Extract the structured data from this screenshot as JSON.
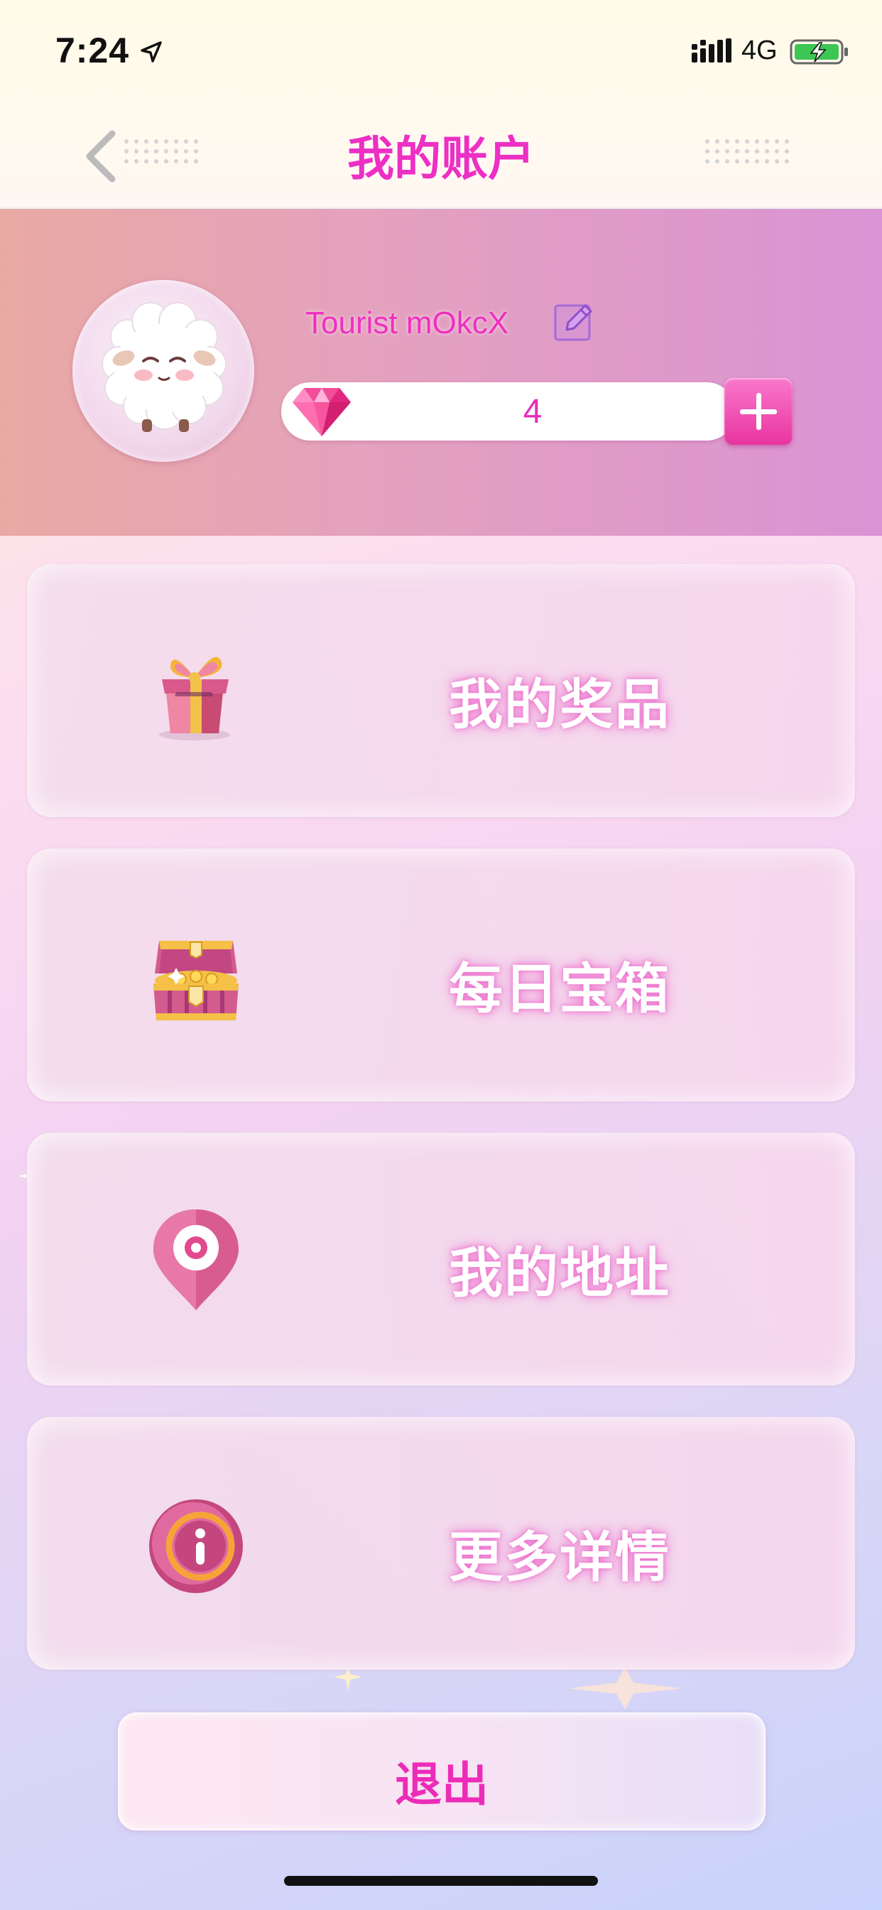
{
  "status_bar": {
    "time": "7:24",
    "network": "4G",
    "icons": [
      "location-arrow-icon",
      "signal-bars-icon",
      "battery-charging-icon"
    ]
  },
  "nav": {
    "title": "我的账户",
    "back_icon": "chevron-left-icon"
  },
  "profile": {
    "username": "Tourist mOkcX",
    "gem_count": "4",
    "avatar_icon": "sheep-avatar-icon",
    "edit_icon": "edit-pencil-icon",
    "gem_icon": "pink-diamond-icon",
    "add_icon": "plus-icon"
  },
  "menu": [
    {
      "label": "我的奖品",
      "icon": "gift-box-icon"
    },
    {
      "label": "每日宝箱",
      "icon": "treasure-chest-icon"
    },
    {
      "label": "我的地址",
      "icon": "location-pin-icon"
    },
    {
      "label": "更多详情",
      "icon": "info-circle-icon"
    }
  ],
  "logout_label": "退出",
  "colors": {
    "accent": "#ee2fc4",
    "header_left": "#e9a9a3",
    "header_right": "#da93d4",
    "plus_button": "#e8349f"
  }
}
